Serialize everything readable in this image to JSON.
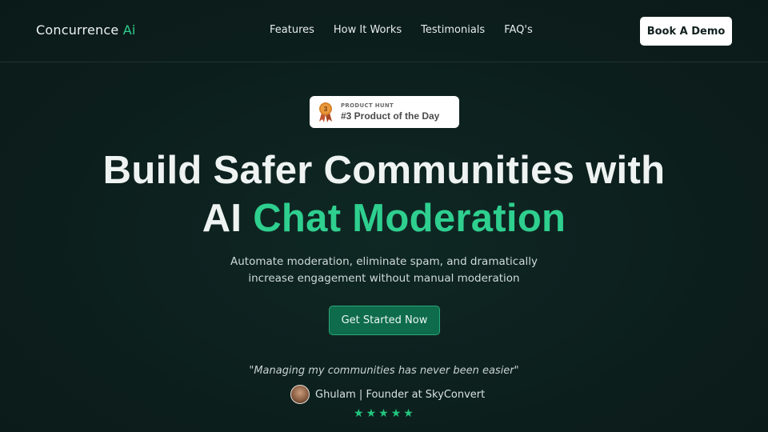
{
  "nav": {
    "logo_main": "Concurrence",
    "logo_accent": "Ai",
    "links": [
      "Features",
      "How It Works",
      "Testimonials",
      "FAQ's"
    ],
    "cta_label": "Book A Demo"
  },
  "badge": {
    "small": "PRODUCT HUNT",
    "main": "#3 Product of the Day",
    "icon": "award-medal-icon"
  },
  "hero": {
    "headline_line1": "Build Safer Communities with",
    "headline_line2_prefix": "AI",
    "headline_line2_accent": "Chat Moderation",
    "sub_line1": "Automate moderation, eliminate spam, and dramatically",
    "sub_line2": "increase engagement without manual moderation",
    "cta_label": "Get Started Now"
  },
  "testimonial": {
    "quote": "\"Managing my communities has never been easier\"",
    "author": "Ghulam | Founder at SkyConvert",
    "rating": 5
  },
  "colors": {
    "background": "#0d1f1d",
    "accent": "#2ecf8f",
    "cta_bg": "#0e6b4c",
    "star": "#22c57e"
  }
}
